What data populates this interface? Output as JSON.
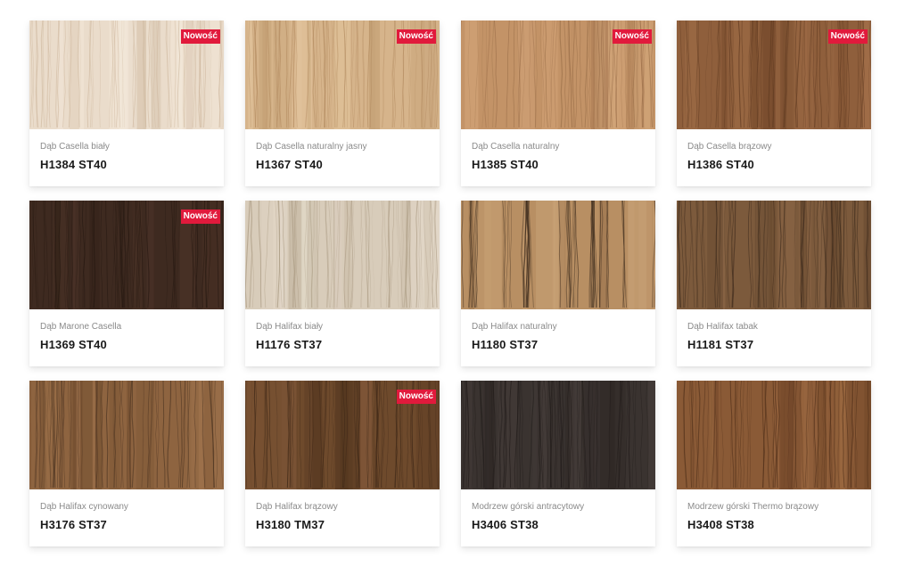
{
  "badge_label": "Nowość",
  "products": [
    {
      "name": "Dąb Casella biały",
      "code": "H1384 ST40",
      "new": true,
      "colors": {
        "base": "#eadccb",
        "light": "#f3e8da",
        "dark": "#d7c3ad",
        "grain": "#cdb69c"
      }
    },
    {
      "name": "Dąb Casella naturalny jasny",
      "code": "H1367 ST40",
      "new": true,
      "colors": {
        "base": "#d6b48b",
        "light": "#e5c7a0",
        "dark": "#bf9a6f",
        "grain": "#b28a5f"
      }
    },
    {
      "name": "Dąb Casella naturalny",
      "code": "H1385 ST40",
      "new": true,
      "colors": {
        "base": "#c39367",
        "light": "#d4a77b",
        "dark": "#a87a52",
        "grain": "#956a45"
      }
    },
    {
      "name": "Dąb Casella brązowy",
      "code": "H1386 ST40",
      "new": true,
      "colors": {
        "base": "#8f5f3c",
        "light": "#a5714b",
        "dark": "#74492b",
        "grain": "#603a21"
      }
    },
    {
      "name": "Dąb Marone Casella",
      "code": "H1369 ST40",
      "new": true,
      "colors": {
        "base": "#3e2a20",
        "light": "#4e3529",
        "dark": "#2e1e16",
        "grain": "#241710"
      }
    },
    {
      "name": "Dąb Halifax biały",
      "code": "H1176 ST37",
      "new": false,
      "colors": {
        "base": "#d8ccba",
        "light": "#e6dccd",
        "dark": "#c2b39e",
        "grain": "#a89880"
      }
    },
    {
      "name": "Dąb Halifax naturalny",
      "code": "H1180 ST37",
      "new": false,
      "colors": {
        "base": "#b88f63",
        "light": "#c9a277",
        "dark": "#9e7650",
        "grain": "#3b2a1c"
      }
    },
    {
      "name": "Dąb Halifax tabak",
      "code": "H1181 ST37",
      "new": false,
      "colors": {
        "base": "#7c5a3c",
        "light": "#8f6a4a",
        "dark": "#62452c",
        "grain": "#3a281a"
      }
    },
    {
      "name": "Dąb Halifax cynowany",
      "code": "H3176 ST37",
      "new": false,
      "colors": {
        "base": "#8e6440",
        "light": "#a37650",
        "dark": "#704c2e",
        "grain": "#4a3220"
      }
    },
    {
      "name": "Dąb Halifax brązowy",
      "code": "H3180 TM37",
      "new": true,
      "colors": {
        "base": "#6e4a2c",
        "light": "#83593a",
        "dark": "#553820",
        "grain": "#3c2616"
      }
    },
    {
      "name": "Modrzew górski antracytowy",
      "code": "H3406 ST38",
      "new": false,
      "colors": {
        "base": "#3a3330",
        "light": "#4a423e",
        "dark": "#2a2422",
        "grain": "#1f1a18"
      }
    },
    {
      "name": "Modrzew górski Thermo brązowy",
      "code": "H3408 ST38",
      "new": false,
      "colors": {
        "base": "#8a5a36",
        "light": "#a06c44",
        "dark": "#6e4428",
        "grain": "#4e2e18"
      }
    }
  ]
}
